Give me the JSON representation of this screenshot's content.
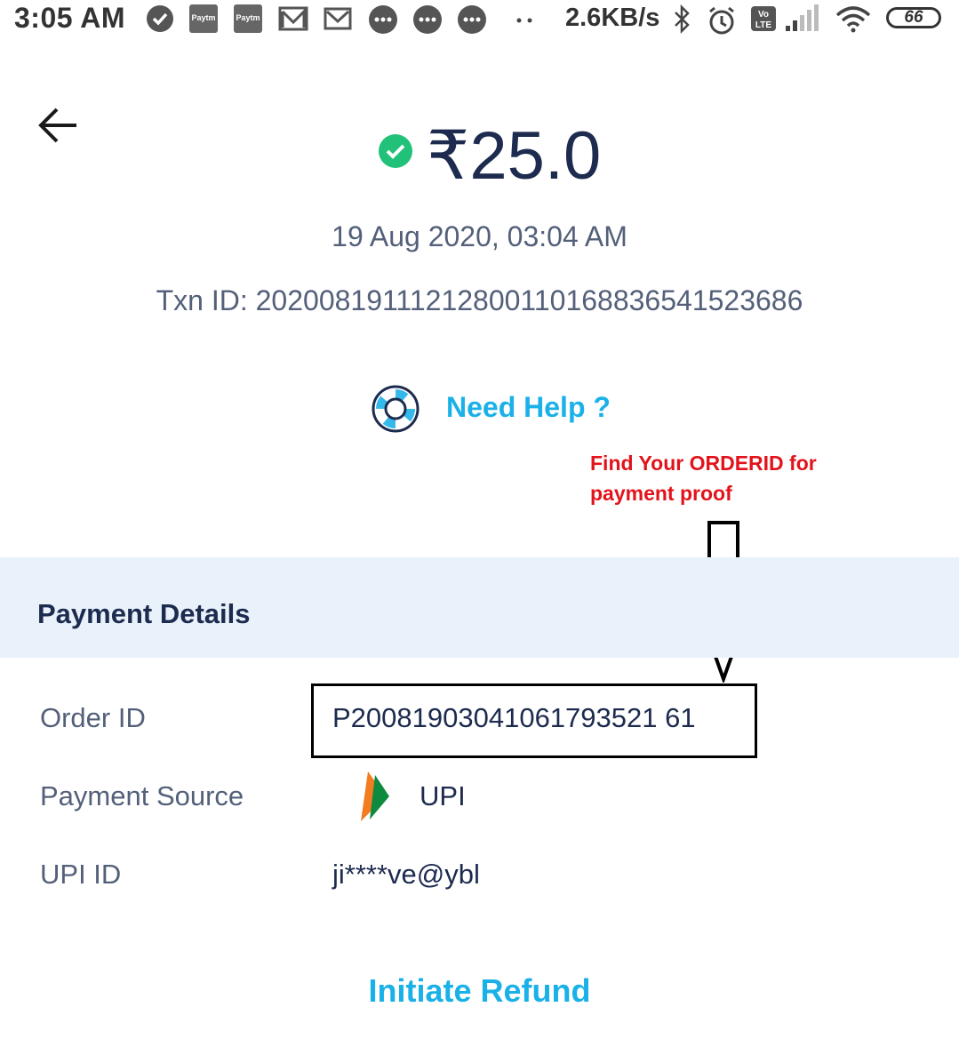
{
  "status_bar": {
    "time": "3:05 AM",
    "net_speed": "2.6KB/s",
    "battery": "66",
    "notification_icons": [
      "check-circle-icon",
      "paytm-business-icon",
      "paytm-business-icon",
      "gmail-icon",
      "gmail-icon",
      "message-icon",
      "message-icon",
      "message-icon",
      "more-dots-icon"
    ],
    "system_icons": [
      "bluetooth-icon",
      "alarm-icon",
      "volte-icon",
      "signal-icon",
      "wifi-icon",
      "battery-icon"
    ]
  },
  "transaction": {
    "amount": "₹25.0",
    "datetime": "19 Aug 2020, 03:04 AM",
    "txn_id": "Txn ID: 20200819111212800110168836541523686",
    "status_color": "#21c17a"
  },
  "help": {
    "label": "Need Help ?"
  },
  "annotation": {
    "line1": "Find Your ORDERID for",
    "line2": "payment proof",
    "color": "#e3131b"
  },
  "payment_details": {
    "title": "Payment Details",
    "rows": [
      {
        "label": "Order ID",
        "value": "P20081903041061793521 61"
      },
      {
        "label": "Payment Source",
        "value": "UPI"
      },
      {
        "label": "UPI ID",
        "value": "ji****ve@ybl"
      }
    ]
  },
  "actions": {
    "refund_label": "Initiate Refund"
  },
  "colors": {
    "accent": "#1ab1e8",
    "navy": "#1d2b4f",
    "section_bg": "#e9f1fb"
  }
}
